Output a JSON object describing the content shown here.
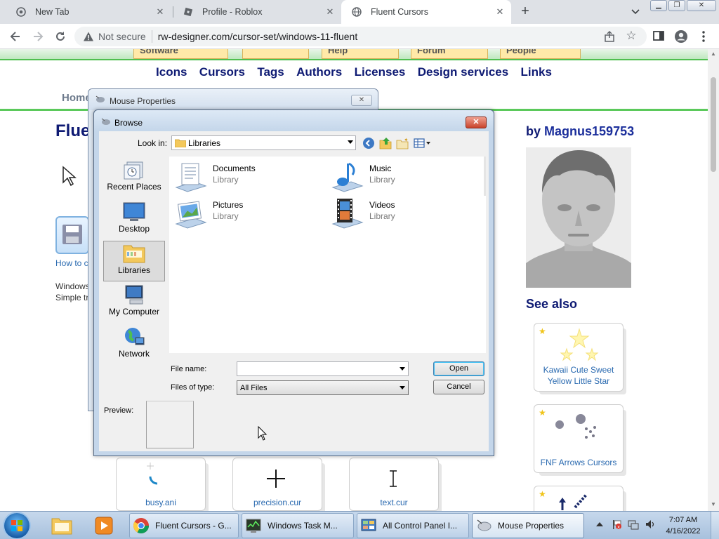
{
  "browser": {
    "tabs": [
      {
        "title": "New Tab"
      },
      {
        "title": "Profile - Roblox"
      },
      {
        "title": "Fluent Cursors"
      }
    ],
    "address": {
      "security": "Not secure",
      "url": "rw-designer.com/cursor-set/windows-11-fluent"
    }
  },
  "site": {
    "old_tabs": [
      "Software",
      "Help",
      "Forum",
      "People"
    ],
    "nav": [
      "Icons",
      "Cursors",
      "Tags",
      "Authors",
      "Licenses",
      "Design services",
      "Links"
    ],
    "breadcrumb": "Home",
    "title": "Flue",
    "how_to": "How to c",
    "desc_line1": "Windows",
    "desc_line2": "Simple tr",
    "by_prefix": "by",
    "author": "Magnus159753",
    "see_also": "See also",
    "see_also_cards": [
      {
        "label": "Kawaii Cute Sweet Yellow Little Star"
      },
      {
        "label": "FNF Arrows Cursors"
      },
      {
        "label": ""
      }
    ],
    "files": [
      {
        "label": "busy.ani"
      },
      {
        "label": "precision.cur"
      },
      {
        "label": "text.cur"
      }
    ]
  },
  "mouse_properties": {
    "title": "Mouse Properties"
  },
  "browse": {
    "title": "Browse",
    "look_in_label": "Look in:",
    "look_in_value": "Libraries",
    "places": [
      {
        "label": "Recent Places"
      },
      {
        "label": "Desktop"
      },
      {
        "label": "Libraries"
      },
      {
        "label": "My Computer"
      },
      {
        "label": "Network"
      }
    ],
    "items": [
      {
        "name": "Documents",
        "type": "Library"
      },
      {
        "name": "Music",
        "type": "Library"
      },
      {
        "name": "Pictures",
        "type": "Library"
      },
      {
        "name": "Videos",
        "type": "Library"
      }
    ],
    "file_name_label": "File name:",
    "file_name_value": "",
    "files_of_type_label": "Files of type:",
    "files_of_type_value": "All Files",
    "open_label": "Open",
    "cancel_label": "Cancel",
    "preview_label": "Preview:"
  },
  "taskbar": {
    "buttons": [
      {
        "label": "Fluent Cursors - G..."
      },
      {
        "label": "Windows Task M..."
      },
      {
        "label": "All Control Panel I..."
      },
      {
        "label": "Mouse Properties"
      }
    ],
    "time": "7:07 AM",
    "date": "4/16/2022"
  }
}
